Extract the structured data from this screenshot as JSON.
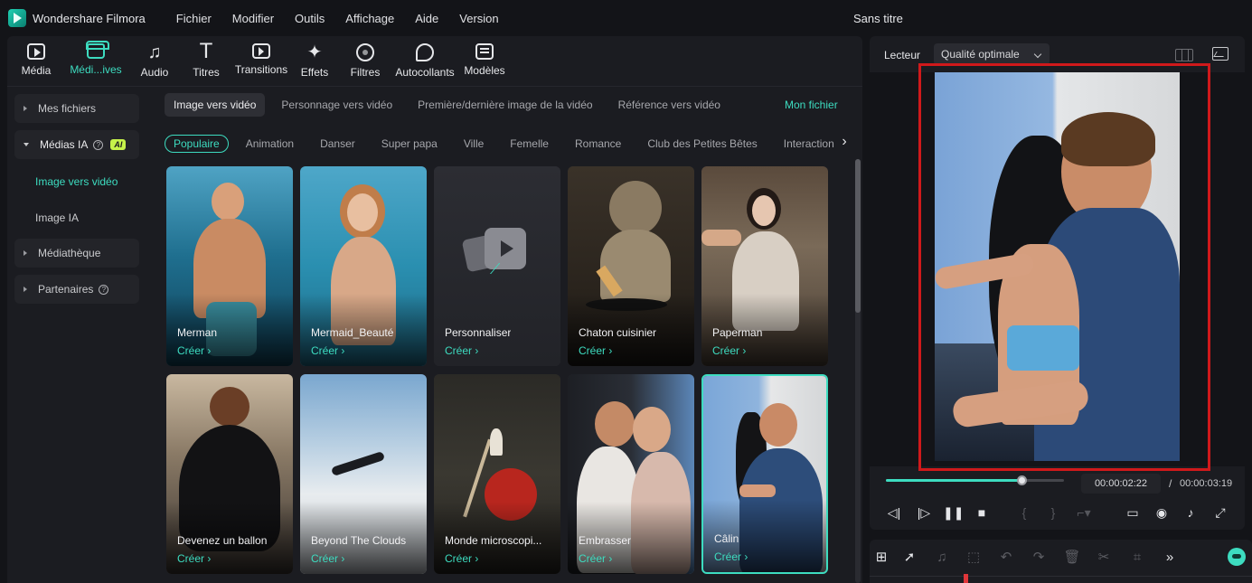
{
  "app": {
    "name": "Wondershare Filmora",
    "doc_title": "Sans titre",
    "menu": [
      "Fichier",
      "Modifier",
      "Outils",
      "Affichage",
      "Aide",
      "Version"
    ]
  },
  "toolbar": {
    "tabs": [
      {
        "label": "Média",
        "icon": "media-icon"
      },
      {
        "label": "Médi...ives",
        "icon": "store-icon"
      },
      {
        "label": "Audio",
        "icon": "audio-icon"
      },
      {
        "label": "Titres",
        "icon": "title-icon"
      },
      {
        "label": "Transitions",
        "icon": "transition-icon"
      },
      {
        "label": "Effets",
        "icon": "effects-icon"
      },
      {
        "label": "Filtres",
        "icon": "filter-icon"
      },
      {
        "label": "Autocollants",
        "icon": "sticker-icon"
      },
      {
        "label": "Modèles",
        "icon": "template-icon"
      }
    ],
    "active_index": 1
  },
  "sidebar": {
    "my_files": "Mes fichiers",
    "ai_media": "Médias IA",
    "ai_badge": "AI",
    "image_to_video": "Image vers vidéo",
    "image_ai": "Image IA",
    "library": "Médiathèque",
    "partners": "Partenaires"
  },
  "subtabs": {
    "items": [
      "Image vers vidéo",
      "Personnage vers vidéo",
      "Première/dernière image de la vidéo",
      "Référence vers vidéo"
    ],
    "active_index": 0,
    "my_file": "Mon fichier"
  },
  "categories": {
    "items": [
      "Populaire",
      "Animation",
      "Danser",
      "Super papa",
      "Ville",
      "Femelle",
      "Romance",
      "Club des Petites Bêtes",
      "Interaction"
    ],
    "active_index": 0
  },
  "cards": {
    "create_label": "Créer ›",
    "items": [
      "Merman",
      "Mermaid_Beauté",
      "Personnaliser",
      "Chaton cuisinier",
      "Paperman",
      "Devenez un ballon",
      "Beyond The Clouds",
      "Monde microscopi...",
      "Embrasser",
      "Câlin"
    ],
    "selected_index": 9
  },
  "player": {
    "label": "Lecteur",
    "quality": "Qualité optimale",
    "time_current": "00:00:02:22",
    "time_separator": "/",
    "time_total": "00:00:03:19",
    "progress": 0.76
  },
  "colors": {
    "accent": "#3ddcc0",
    "highlight_box": "#d0191b",
    "panel_bg": "#1b1c21",
    "app_bg": "#131418",
    "ai_badge": "#c6f24a"
  }
}
